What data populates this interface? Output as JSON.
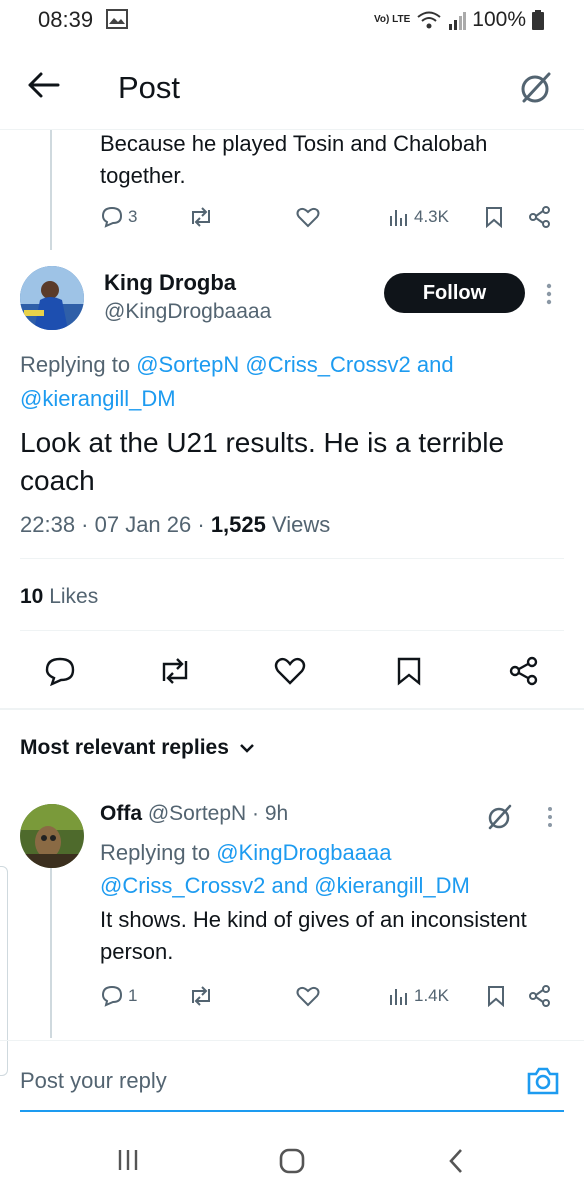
{
  "status": {
    "time": "08:39",
    "network": "Vo) LTE",
    "battery": "100%"
  },
  "header": {
    "title": "Post"
  },
  "prev_post": {
    "text": "Because he played Tosin and Chalobah together.",
    "replies": "3",
    "views": "4.3K"
  },
  "main_post": {
    "name": "King Drogba",
    "handle": "@KingDrogbaaaa",
    "follow_label": "Follow",
    "replying_prefix": "Replying to",
    "replying_to": [
      "@SortepN",
      "@Criss_Crossv2",
      "and",
      "@kierangill_DM"
    ],
    "text": "Look at the U21 results. He is a terrible coach",
    "time": "22:38 · 07 Jan 26 ·",
    "views_count": "1,525",
    "views_label": "Views",
    "likes_count": "10",
    "likes_label": "Likes"
  },
  "replies_section": {
    "sort_label": "Most relevant replies"
  },
  "reply": {
    "name": "Offa",
    "handle": "@SortepN",
    "age": "· 9h",
    "replying_prefix": "Replying to",
    "replying_line1": "@KingDrogbaaaa",
    "replying_line2": "@Criss_Crossv2 and @kierangill_DM",
    "text": "It shows. He kind of gives of an inconsistent person.",
    "replies": "1",
    "views": "1.4K"
  },
  "composer": {
    "placeholder": "Post your reply"
  },
  "colors": {
    "accent": "#1d9bf0",
    "text": "#0f1419",
    "muted": "#536471"
  }
}
